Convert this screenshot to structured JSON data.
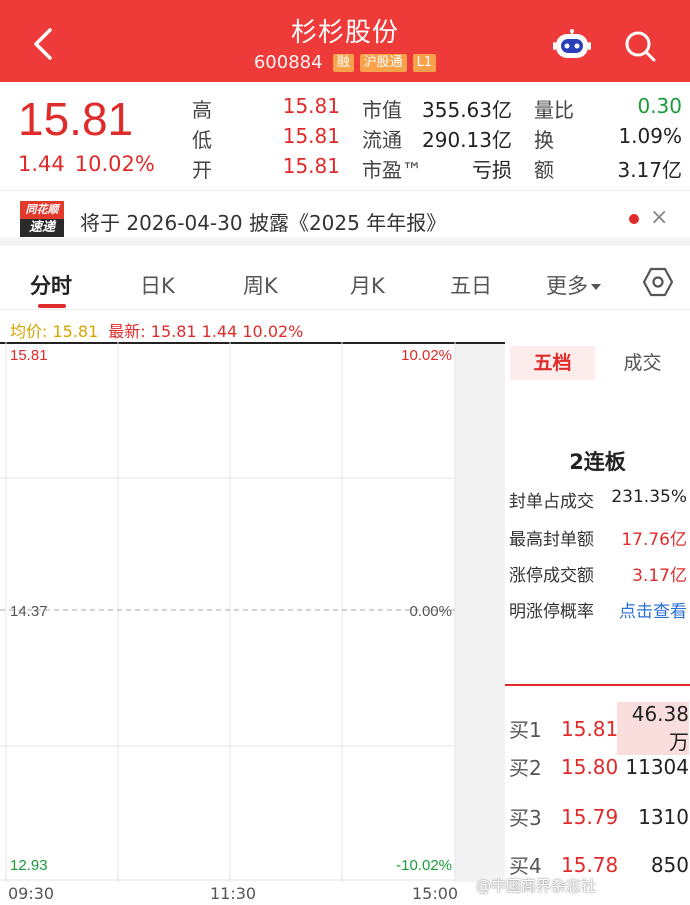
{
  "header": {
    "title": "杉杉股份",
    "code": "600884",
    "tags": [
      "融",
      "沪股通",
      "L1"
    ],
    "bg_color": "#ef3a3a"
  },
  "quote": {
    "price": "15.81",
    "change": "1.44",
    "change_pct": "10.02%",
    "grid": [
      {
        "label": "高",
        "value": "15.81"
      },
      {
        "label": "低",
        "value": "15.81"
      },
      {
        "label": "开",
        "value": "15.81"
      },
      {
        "label": "市值",
        "value": "355.63亿"
      },
      {
        "label": "流通",
        "value": "290.13亿"
      },
      {
        "label": "市盈™",
        "value": "亏损"
      },
      {
        "label": "量比",
        "value": "0.30"
      },
      {
        "label": "换",
        "value": "1.09%"
      },
      {
        "label": "额",
        "value": "3.17亿"
      }
    ]
  },
  "announcement": {
    "logo_top": "同花顺",
    "logo_bottom": "速递",
    "text": "将于 2026-04-30 披露《2025 年年报》",
    "close": "×"
  },
  "tabs": [
    {
      "label": "分时",
      "active": true
    },
    {
      "label": "日K"
    },
    {
      "label": "周K"
    },
    {
      "label": "月K"
    },
    {
      "label": "五日"
    },
    {
      "label": "更多"
    }
  ],
  "avg_line": {
    "avg": "均价: 15.81",
    "latest": "最新: 15.81  1.44  10.02%"
  },
  "chart": {
    "y_top": "15.81",
    "y_mid": "14.37",
    "y_bottom": "12.93",
    "pct_top": "10.02%",
    "pct_mid": "0.00%",
    "pct_bottom": "-10.02%",
    "times": [
      "09:30",
      "11:30",
      "15:00"
    ]
  },
  "panel": {
    "tabs": [
      "五档",
      "成交"
    ],
    "lianban": "2连板",
    "rows": [
      {
        "label": "封单占成交",
        "value": "231.35%"
      },
      {
        "label": "最高封单额",
        "value": "17.76亿"
      },
      {
        "label": "涨停成交额",
        "value": "3.17亿"
      },
      {
        "label": "明涨停概率",
        "value": "点击查看"
      }
    ],
    "bids": [
      {
        "label": "买1",
        "price": "15.81",
        "volume": "46.38万"
      },
      {
        "label": "买2",
        "price": "15.80",
        "volume": "11304"
      },
      {
        "label": "买3",
        "price": "15.79",
        "volume": "1310"
      },
      {
        "label": "买4",
        "price": "15.78",
        "volume": "850"
      }
    ]
  },
  "watermark": "@中国商界杂志社"
}
